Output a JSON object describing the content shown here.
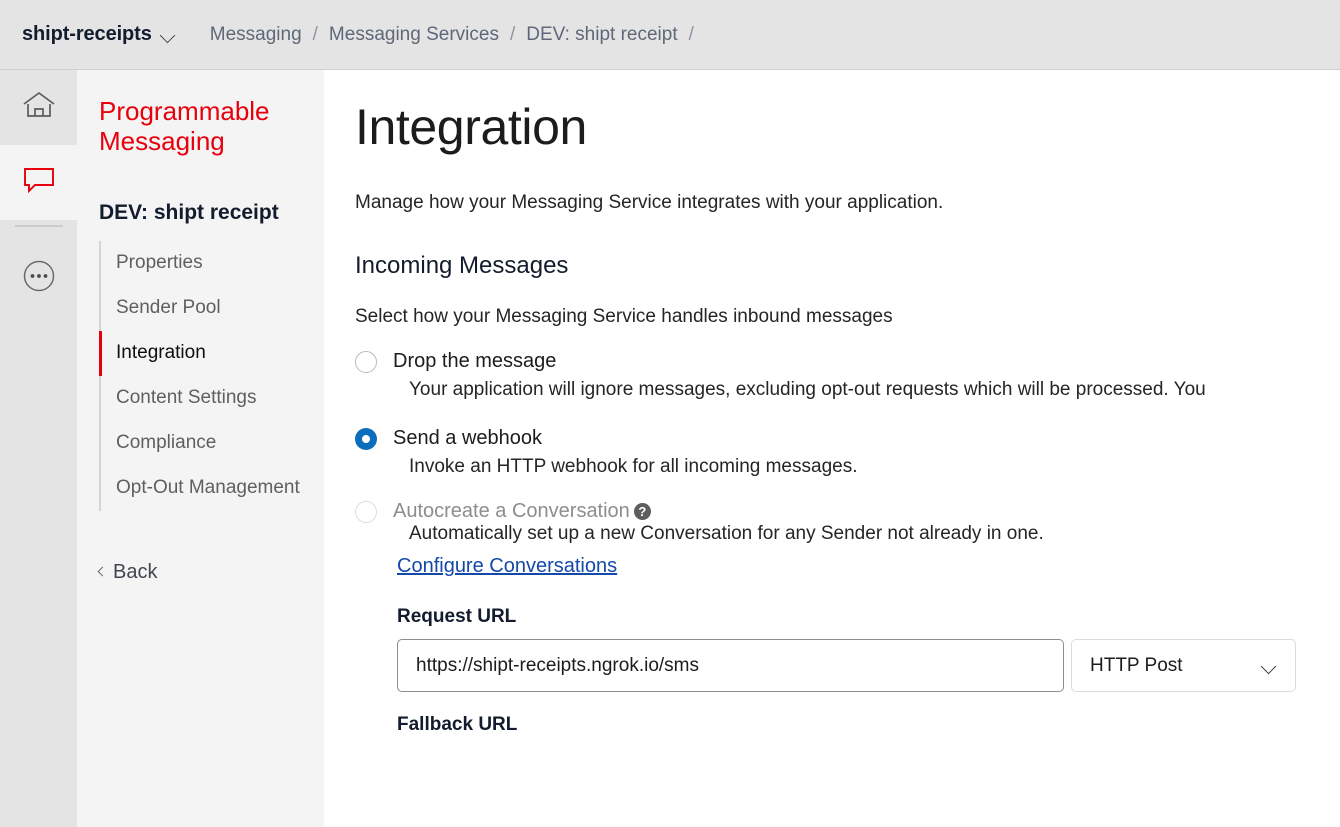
{
  "topbar": {
    "account": "shipt-receipts",
    "account_chevron_icon": "chevron-down-icon",
    "breadcrumb": [
      {
        "label": "Messaging"
      },
      {
        "label": "Messaging Services"
      },
      {
        "label": "DEV: shipt receipt"
      }
    ],
    "separator": "/",
    "trailing_separator": "/"
  },
  "icon_rail": {
    "items": [
      {
        "icon": "home-icon",
        "active": false
      },
      {
        "icon": "chat-bubble-icon",
        "active": true
      },
      {
        "icon": "ellipsis-circle-icon",
        "active": false
      }
    ]
  },
  "sidebar": {
    "product_title": "Programmable Messaging",
    "service_name": "DEV: shipt receipt",
    "nav_items": [
      {
        "label": "Properties",
        "active": false
      },
      {
        "label": "Sender Pool",
        "active": false
      },
      {
        "label": "Integration",
        "active": true
      },
      {
        "label": "Content Settings",
        "active": false
      },
      {
        "label": "Compliance",
        "active": false
      },
      {
        "label": "Opt-Out Management",
        "active": false
      }
    ],
    "back_label": "Back",
    "back_icon": "chevron-left-icon"
  },
  "main": {
    "page_title": "Integration",
    "intro": "Manage how your Messaging Service integrates with your application.",
    "section_heading": "Incoming Messages",
    "section_subheading": "Select how your Messaging Service handles inbound messages",
    "options": [
      {
        "label": "Drop the message",
        "description": "Your application will ignore messages, excluding opt-out requests which will be processed. You",
        "selected": false,
        "disabled": false
      },
      {
        "label": "Send a webhook",
        "description": "Invoke an HTTP webhook for all incoming messages.",
        "selected": true,
        "disabled": false
      },
      {
        "label": "Autocreate a Conversation",
        "description": "Automatically set up a new Conversation for any Sender not already in one.",
        "selected": false,
        "disabled": true,
        "help_icon": "question-mark-icon",
        "help_glyph": "?"
      }
    ],
    "configure_link": "Configure Conversations",
    "request_url": {
      "label": "Request URL",
      "value": "https://shipt-receipts.ngrok.io/sms",
      "placeholder": "https://"
    },
    "method": {
      "selected": "HTTP Post",
      "chevron_icon": "chevron-down-icon"
    },
    "fallback_url_label": "Fallback URL"
  },
  "colors": {
    "brand_red": "#e8000d",
    "accent_blue": "#0b6ebc",
    "link_blue": "#1349a8",
    "topbar_bg": "#e4e4e4",
    "sidebar_bg": "#f4f4f4"
  }
}
